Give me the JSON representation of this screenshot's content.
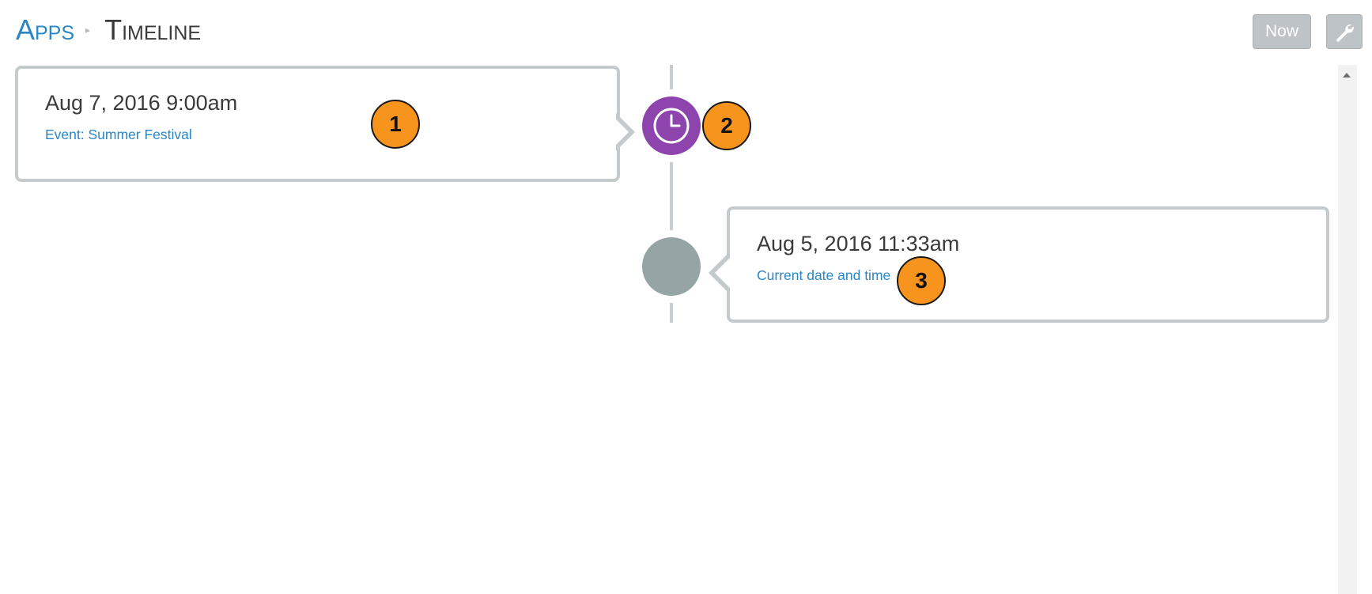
{
  "header": {
    "breadcrumb_root": "Apps",
    "breadcrumb_separator": "▸",
    "page_title": "Timeline",
    "now_button_label": "Now",
    "tools_button_icon": "wrench-icon"
  },
  "timeline": {
    "events": [
      {
        "date": "Aug 7, 2016 9:00am",
        "description": "Event: Summer Festival",
        "side": "left",
        "node_icon": "clock-icon",
        "node_color": "#8e44ad"
      },
      {
        "date": "Aug 5, 2016 11:33am",
        "description": "Current date and time",
        "side": "right",
        "node_icon": "none",
        "node_color": "#95a5a6"
      }
    ]
  },
  "callouts": [
    "1",
    "2",
    "3"
  ],
  "colors": {
    "link": "#2a86c4",
    "button_bg": "#bdc3c7",
    "card_border": "#c5cacd",
    "callout": "#f7941d"
  }
}
